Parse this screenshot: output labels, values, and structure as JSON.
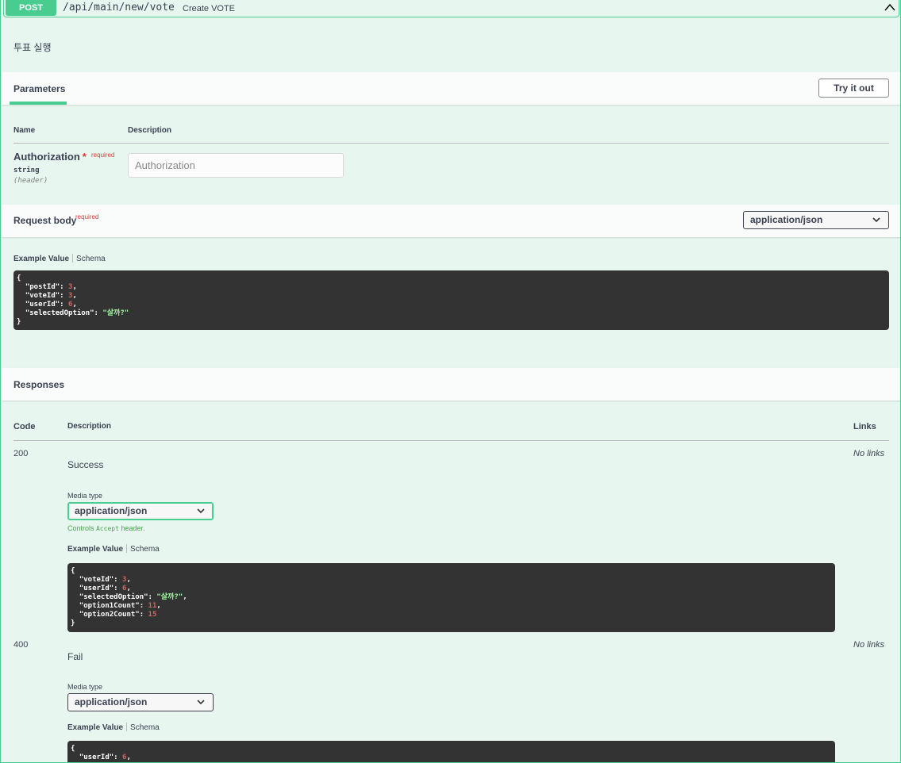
{
  "summary": {
    "method": "POST",
    "path": "/api/main/new/vote",
    "description": "Create VOTE"
  },
  "operation_description": "투표 실행",
  "parameters": {
    "tab_label": "Parameters",
    "try_button": "Try it out",
    "col_name": "Name",
    "col_description": "Description",
    "param": {
      "name": "Authorization",
      "star": "*",
      "required": "required",
      "type": "string",
      "in": "(header)",
      "placeholder": "Authorization"
    }
  },
  "request_body": {
    "title": "Request body",
    "required": "required",
    "content_type": "application/json",
    "example_tab": "Example Value",
    "schema_tab": "Schema"
  },
  "responses": {
    "title": "Responses",
    "col_code": "Code",
    "col_description": "Description",
    "col_links": "Links",
    "media_type_label": "Media type",
    "controls_note_prefix": "Controls",
    "controls_note_code": "Accept",
    "controls_note_suffix": "header.",
    "items": [
      {
        "code": "200",
        "description": "Success",
        "links": "No links",
        "media_type": "application/json",
        "example_tab": "Example Value",
        "schema_tab": "Schema"
      },
      {
        "code": "400",
        "description": "Fail",
        "links": "No links",
        "media_type": "application/json",
        "example_tab": "Example Value",
        "schema_tab": "Schema"
      }
    ]
  },
  "colors": {
    "post_green": "#49cc90",
    "block_bg": "#e8f6f0",
    "code_bg": "#333333",
    "number": "#d36363",
    "string": "#a2fca2",
    "required": "#d63a3a"
  },
  "icons": [
    "chevron-up-icon",
    "chevron-down-icon"
  ]
}
